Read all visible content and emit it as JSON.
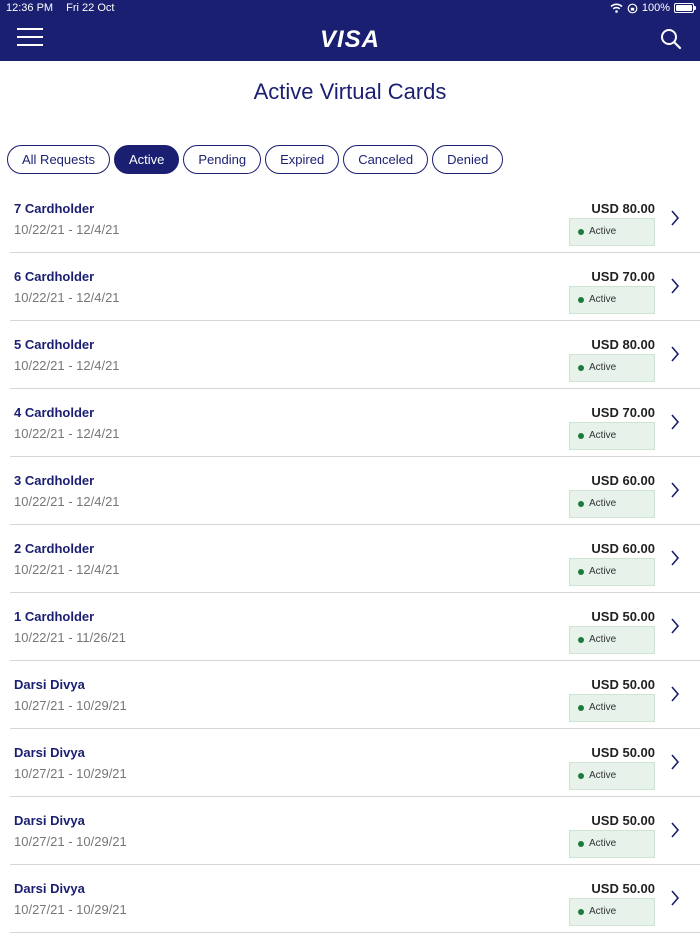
{
  "status_bar": {
    "time": "12:36 PM",
    "date": "Fri 22 Oct",
    "battery": "100%"
  },
  "header": {
    "logo": "VISA"
  },
  "page": {
    "title": "Active Virtual Cards"
  },
  "filters": [
    {
      "label": "All Requests",
      "active": false
    },
    {
      "label": "Active",
      "active": true
    },
    {
      "label": "Pending",
      "active": false
    },
    {
      "label": "Expired",
      "active": false
    },
    {
      "label": "Canceled",
      "active": false
    },
    {
      "label": "Denied",
      "active": false
    }
  ],
  "cards": [
    {
      "name": "7  Cardholder",
      "dates": "10/22/21 - 12/4/21",
      "amount": "USD 80.00",
      "status": "Active"
    },
    {
      "name": "6  Cardholder",
      "dates": "10/22/21 - 12/4/21",
      "amount": "USD 70.00",
      "status": "Active"
    },
    {
      "name": "5  Cardholder",
      "dates": "10/22/21 - 12/4/21",
      "amount": "USD 80.00",
      "status": "Active"
    },
    {
      "name": "4  Cardholder",
      "dates": "10/22/21 - 12/4/21",
      "amount": "USD 70.00",
      "status": "Active"
    },
    {
      "name": "3  Cardholder",
      "dates": "10/22/21 - 12/4/21",
      "amount": "USD 60.00",
      "status": "Active"
    },
    {
      "name": "2  Cardholder",
      "dates": "10/22/21 - 12/4/21",
      "amount": "USD 60.00",
      "status": "Active"
    },
    {
      "name": "1  Cardholder",
      "dates": "10/22/21 - 11/26/21",
      "amount": "USD 50.00",
      "status": "Active"
    },
    {
      "name": "Darsi  Divya",
      "dates": "10/27/21 - 10/29/21",
      "amount": "USD 50.00",
      "status": "Active"
    },
    {
      "name": "Darsi  Divya",
      "dates": "10/27/21 - 10/29/21",
      "amount": "USD 50.00",
      "status": "Active"
    },
    {
      "name": "Darsi  Divya",
      "dates": "10/27/21 - 10/29/21",
      "amount": "USD 50.00",
      "status": "Active"
    },
    {
      "name": "Darsi  Divya",
      "dates": "10/27/21 - 10/29/21",
      "amount": "USD 50.00",
      "status": "Active"
    }
  ],
  "colors": {
    "brand": "#1a1f71",
    "status_active": "#1b7a3e",
    "badge_bg": "#e6f2ea"
  },
  "icons": {
    "menu": "hamburger-icon",
    "search": "search-icon",
    "wifi": "wifi-icon",
    "lock": "rotation-lock-icon",
    "battery": "battery-icon",
    "row": "chevron-right-icon",
    "status": "status-dot-icon"
  }
}
